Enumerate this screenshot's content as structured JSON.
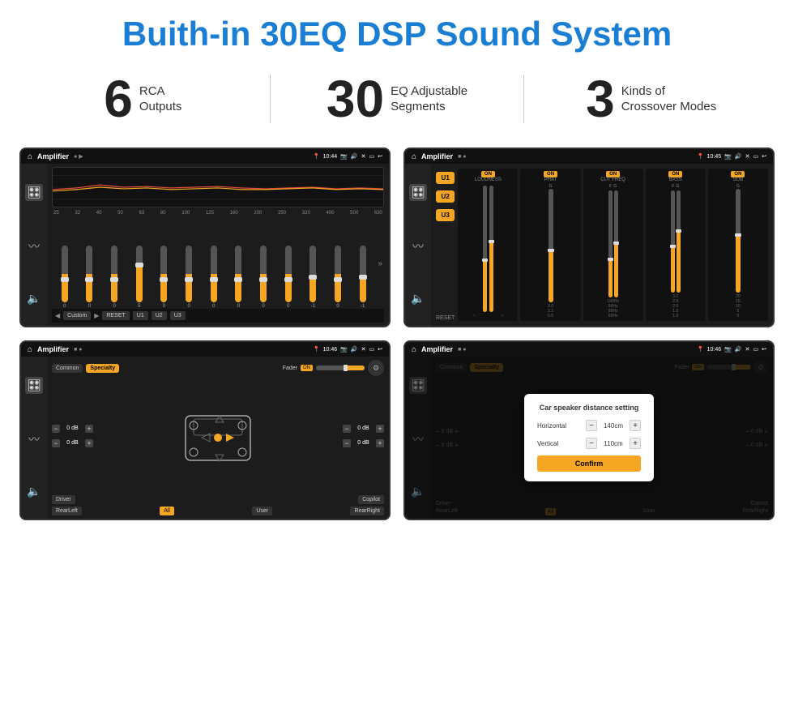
{
  "header": {
    "title": "Buith-in 30EQ DSP Sound System"
  },
  "stats": [
    {
      "number": "6",
      "text_line1": "RCA",
      "text_line2": "Outputs"
    },
    {
      "number": "30",
      "text_line1": "EQ Adjustable",
      "text_line2": "Segments"
    },
    {
      "number": "3",
      "text_line1": "Kinds of",
      "text_line2": "Crossover Modes"
    }
  ],
  "screens": [
    {
      "id": "eq-screen",
      "statusbar": {
        "home": "⌂",
        "title": "Amplifier",
        "time": "10:44"
      },
      "type": "eq"
    },
    {
      "id": "xover-screen",
      "statusbar": {
        "home": "⌂",
        "title": "Amplifier",
        "time": "10:45"
      },
      "type": "crossover"
    },
    {
      "id": "fader-screen",
      "statusbar": {
        "home": "⌂",
        "title": "Amplifier",
        "time": "10:46"
      },
      "type": "fader"
    },
    {
      "id": "distance-screen",
      "statusbar": {
        "home": "⌂",
        "title": "Amplifier",
        "time": "10:46"
      },
      "type": "distance",
      "dialog": {
        "title": "Car speaker distance setting",
        "horizontal_label": "Horizontal",
        "horizontal_value": "140cm",
        "vertical_label": "Vertical",
        "vertical_value": "110cm",
        "confirm_label": "Confirm"
      }
    }
  ],
  "eq": {
    "freq_labels": [
      "25",
      "32",
      "40",
      "50",
      "63",
      "80",
      "100",
      "125",
      "160",
      "200",
      "250",
      "320",
      "400",
      "500",
      "630"
    ],
    "values": [
      "0",
      "0",
      "0",
      "5",
      "0",
      "0",
      "0",
      "0",
      "0",
      "0",
      "-1",
      "0",
      "-1"
    ],
    "preset": "Custom",
    "buttons": [
      "RESET",
      "U1",
      "U2",
      "U3"
    ]
  },
  "crossover": {
    "presets": [
      "U1",
      "U2",
      "U3"
    ],
    "channels": [
      "LOUDNESS",
      "PHAT",
      "CUT FREQ",
      "BASS",
      "SUB"
    ],
    "on_label": "ON",
    "reset_label": "RESET"
  },
  "fader": {
    "tabs": [
      "Common",
      "Specialty"
    ],
    "fader_label": "Fader",
    "on_label": "ON",
    "db_values": [
      "0 dB",
      "0 dB",
      "0 dB",
      "0 dB"
    ],
    "bottom_buttons": [
      "Driver",
      "Copilot",
      "RearLeft",
      "All",
      "User",
      "RearRight"
    ]
  }
}
